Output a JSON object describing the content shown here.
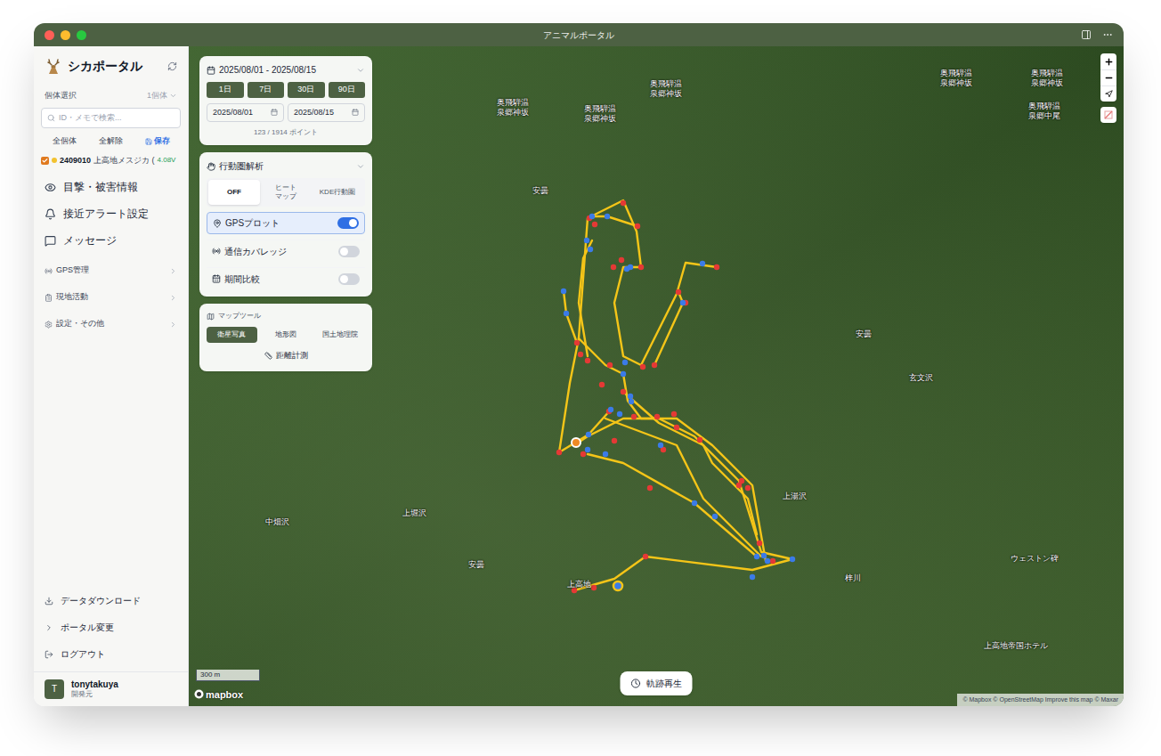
{
  "window": {
    "title": "アニマルポータル"
  },
  "sidebar": {
    "logo": "シカポータル",
    "selection": {
      "label": "個体選択",
      "count": "1個体"
    },
    "search": {
      "placeholder": "ID・メモで検索..."
    },
    "actions": [
      {
        "label": "全個体",
        "kind": "plain"
      },
      {
        "label": "全解除",
        "kind": "plain"
      },
      {
        "label": "保存",
        "kind": "save"
      }
    ],
    "animals": [
      {
        "id": "2409010",
        "name": "上高地メスジカ (",
        "voltage": "4.08V",
        "checked": true,
        "color": "#f2c230"
      }
    ],
    "nav": [
      {
        "label": "目撃・被害情報",
        "kind": "main",
        "icon": "eye"
      },
      {
        "label": "接近アラート設定",
        "kind": "main",
        "icon": "bell"
      },
      {
        "label": "メッセージ",
        "kind": "main",
        "icon": "message"
      },
      {
        "label": "GPS管理",
        "kind": "sub",
        "icon": "radio"
      },
      {
        "label": "現地活動",
        "kind": "sub",
        "icon": "clipboard"
      },
      {
        "label": "設定・その他",
        "kind": "sub",
        "icon": "settings"
      }
    ],
    "footer": [
      {
        "label": "データダウンロード",
        "icon": "download"
      },
      {
        "label": "ポータル変更",
        "icon": "chevron"
      },
      {
        "label": "ログアウト",
        "icon": "logout"
      }
    ],
    "user": {
      "initial": "T",
      "name": "tonytakuya",
      "role": "開発元"
    }
  },
  "date_panel": {
    "range": "2025/08/01 - 2025/08/15",
    "presets": [
      {
        "label": "1日"
      },
      {
        "label": "7日"
      },
      {
        "label": "30日"
      },
      {
        "label": "90日"
      }
    ],
    "start": "2025/08/01",
    "end": "2025/08/15",
    "points": "123 / 1914 ポイント"
  },
  "analysis_panel": {
    "title": "行動圏解析",
    "modes": [
      {
        "label": "OFF",
        "selected": true
      },
      {
        "label": "ヒート\nマップ",
        "selected": false
      },
      {
        "label": "KDE行動圏",
        "selected": false
      }
    ],
    "toggles": [
      {
        "label": "GPSプロット",
        "on": true,
        "icon": "pin"
      },
      {
        "label": "通信カバレッジ",
        "on": false,
        "icon": "radio"
      },
      {
        "label": "期間比較",
        "on": false,
        "icon": "calendar"
      }
    ]
  },
  "map_tools": {
    "title": "マップツール",
    "layers": [
      {
        "label": "衛星写真",
        "selected": true
      },
      {
        "label": "地形図",
        "selected": false
      },
      {
        "label": "国土地理院",
        "selected": false
      }
    ],
    "measure": "距離計測"
  },
  "map": {
    "labels": [
      "奥飛騨温\n泉郷神坂",
      "奥飛騨温\n泉郷神坂",
      "奥飛騨温\n泉郷神坂",
      "奥飛騨温\n泉郷神坂",
      "奥飛騨温\n泉郷神坂",
      "奥飛騨温\n泉郷中尾",
      "安曇",
      "安曇",
      "玄文沢",
      "上湯沢",
      "中畑沢",
      "上堀沢",
      "安曇",
      "上高地",
      "梓川",
      "ウェストン碑",
      "上高地帝国ホテル"
    ],
    "scale": "300 m",
    "logo": "mapbox",
    "attribution": "© Mapbox © OpenStreetMap Improve this map © Maxar",
    "playback": "軌跡再生"
  }
}
